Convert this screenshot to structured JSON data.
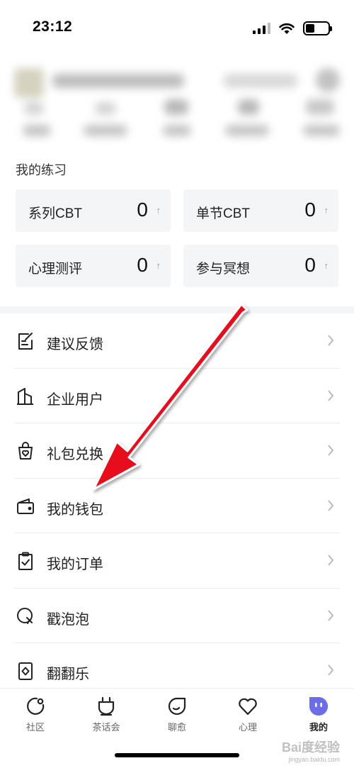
{
  "status": {
    "time": "23:12"
  },
  "practice": {
    "title": "我的练习",
    "cards": [
      {
        "label": "系列CBT",
        "value": "0",
        "arrow": "↑"
      },
      {
        "label": "单节CBT",
        "value": "0",
        "arrow": "↑"
      },
      {
        "label": "心理测评",
        "value": "0",
        "arrow": "↑"
      },
      {
        "label": "参与冥想",
        "value": "0",
        "arrow": "↑"
      }
    ]
  },
  "menu": [
    {
      "label": "建议反馈",
      "icon": "feedback-icon"
    },
    {
      "label": "企业用户",
      "icon": "building-icon"
    },
    {
      "label": "礼包兑换",
      "icon": "gift-bag-icon"
    },
    {
      "label": "我的钱包",
      "icon": "wallet-icon"
    },
    {
      "label": "我的订单",
      "icon": "clipboard-check-icon"
    },
    {
      "label": "戳泡泡",
      "icon": "bubble-icon"
    },
    {
      "label": "翻翻乐",
      "icon": "card-flip-icon"
    }
  ],
  "nav": [
    {
      "label": "社区",
      "icon": "community-icon"
    },
    {
      "label": "茶话会",
      "icon": "tea-cup-icon"
    },
    {
      "label": "聊愈",
      "icon": "chat-leaf-icon"
    },
    {
      "label": "心理",
      "icon": "heart-icon"
    },
    {
      "label": "我的",
      "icon": "profile-face-icon",
      "active": true
    }
  ],
  "watermark": {
    "text": "Bai度经验",
    "sub": "jingyan.baidu.com"
  },
  "colors": {
    "accent": "#6b6ee8",
    "annotation": "#e8101a"
  }
}
